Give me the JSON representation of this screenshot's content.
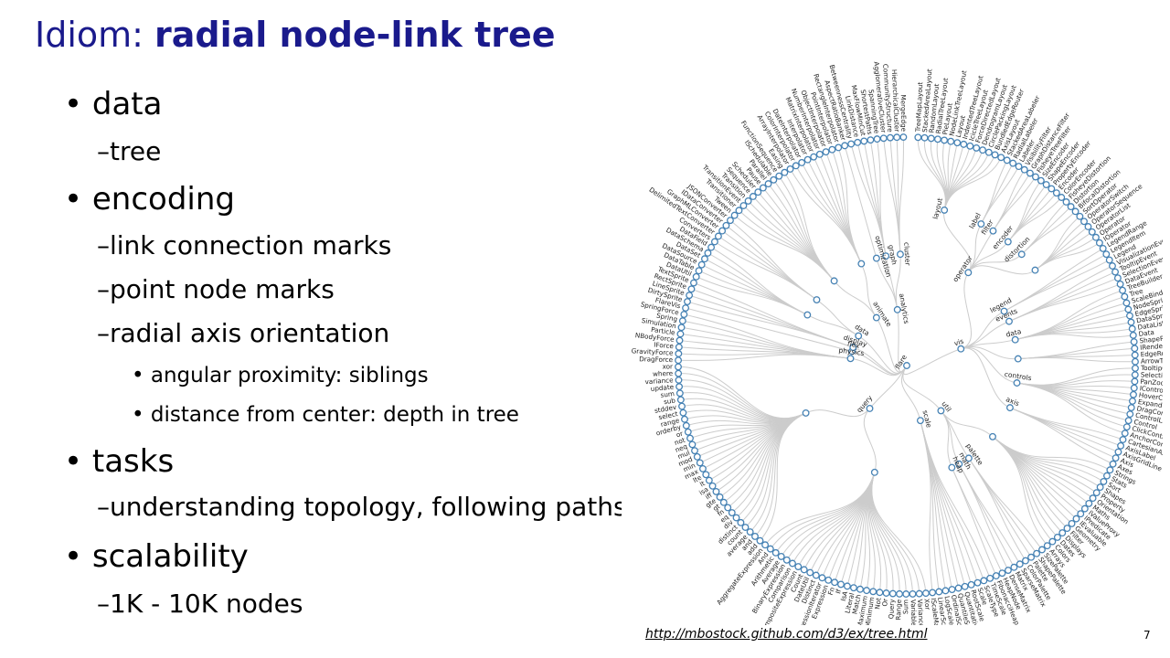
{
  "slide": {
    "title_regular": "Idiom: ",
    "title_bold": "radial node-link tree",
    "bullets": [
      {
        "level": 1,
        "marker": "•",
        "text": "data"
      },
      {
        "level": 2,
        "marker": "–",
        "text": "tree"
      },
      {
        "level": 1,
        "marker": "•",
        "text": "encoding"
      },
      {
        "level": 2,
        "marker": "–",
        "text": "link connection marks"
      },
      {
        "level": 2,
        "marker": "–",
        "text": "point node marks"
      },
      {
        "level": 2,
        "marker": "–",
        "text": "radial axis orientation"
      },
      {
        "level": 3,
        "marker": "•",
        "text": "angular proximity: siblings"
      },
      {
        "level": 3,
        "marker": "•",
        "text": "distance from center: depth in tree"
      },
      {
        "level": 1,
        "marker": "•",
        "text": "tasks"
      },
      {
        "level": 2,
        "marker": "–",
        "text": "understanding topology,  following paths"
      },
      {
        "level": 1,
        "marker": "•",
        "text": "scalability"
      },
      {
        "level": 2,
        "marker": "–",
        "text": "1K - 10K nodes"
      }
    ],
    "footer_link": "http://mbostock.github.com/d3/ex/tree.html",
    "page_number": "7"
  },
  "tree": {
    "root": "flare",
    "groups": [
      {
        "name": "vis",
        "children": [
          {
            "name": "operator",
            "children": [
              {
                "name": "layout",
                "children": [
                  "TreeMapLayout",
                  "StackedAreaLayout",
                  "RandomLayout",
                  "RadialTreeLayout",
                  "PieLayout",
                  "NodeLinkTreeLayout",
                  "Layout",
                  "IndentedTreeLayout",
                  "IcicleTreeLayout",
                  "ForceDirectedLayout",
                  "DendrogramLayout",
                  "CirclePackingLayout",
                  "BundledEdgeRouter",
                  "AxisLayout"
                ]
              },
              {
                "name": "label",
                "children": [
                  "StackedAreaLabeler",
                  "RadialLabeler",
                  "Labeler"
                ]
              },
              {
                "name": "filter",
                "children": [
                  "VisibilityFilter",
                  "GraphDistanceFilter",
                  "FisheyeTreeFilter"
                ]
              },
              {
                "name": "encoder",
                "children": [
                  "SizeEncoder",
                  "ShapeEncoder",
                  "PropertyEncoder",
                  "Encoder",
                  "ColorEncoder"
                ]
              },
              {
                "name": "distortion",
                "children": [
                  "FisheyeDistortion",
                  "Distortion",
                  "BifocalDistortion"
                ]
              },
              {
                "name": "leaves",
                "children": [
                  "SortOperator",
                  "OperatorSwitch",
                  "OperatorSequence",
                  "OperatorList",
                  "Operator",
                  "IOperator"
                ]
              }
            ]
          },
          {
            "name": "legend",
            "children": [
              "LegendRange",
              "LegendItem",
              "Legend"
            ]
          },
          {
            "name": "events",
            "children": [
              "VisualizationEvent",
              "TooltipEvent",
              "SelectionEvent",
              "DataEvent"
            ]
          },
          {
            "name": "data",
            "children": [
              "TreeBuilder",
              "Tree",
              "ScaleBinding",
              "NodeSprite",
              "EdgeSprite",
              "DataSprite",
              "DataList",
              "Data"
            ]
          },
          {
            "name": "data-render",
            "children": [
              "ShapeRenderer",
              "IRenderer",
              "EdgeRenderer",
              "ArrowType"
            ]
          },
          {
            "name": "controls",
            "children": [
              "TooltipControl",
              "SelectionControl",
              "PanZoomControl",
              "IControl",
              "HoverControl",
              "ExpandControl",
              "DragControl",
              "ControlList",
              "Control",
              "ClickControl",
              "AnchorControl"
            ]
          },
          {
            "name": "axis",
            "children": [
              "CartesianAxes",
              "AxisLabel",
              "AxisGridLine",
              "Axis",
              "Axes"
            ]
          }
        ]
      },
      {
        "name": "util",
        "children": [
          {
            "name": "leaves",
            "children": [
              "Strings",
              "Stats",
              "Sort",
              "Shapes",
              "Property",
              "Orientation",
              "Maths",
              "IValueProxy",
              "IPredicate",
              "IEvaluable",
              "Geometry",
              "Filter",
              "Displays",
              "Dates",
              "Colors",
              "Arrays"
            ]
          },
          {
            "name": "palette",
            "children": [
              "SizePalette",
              "ShapePalette",
              "Palette",
              "ColorPalette"
            ]
          },
          {
            "name": "math",
            "children": [
              "SparseMatrix",
              "Matrix",
              "DenseMatrix"
            ]
          },
          {
            "name": "heap",
            "children": [
              "HeapNode",
              "FibonacciHeap"
            ]
          }
        ]
      },
      {
        "name": "scale",
        "children": [
          "TimeScale",
          "ScaleType",
          "Scale",
          "RootScale",
          "QuantitativeScale",
          "QuantileScale",
          "OrdinalScale",
          "LogScale",
          "LinearScale",
          "IScaleMap"
        ]
      },
      {
        "name": "query",
        "children": [
          {
            "name": "leaves",
            "children": [
              "Xor",
              "Variance",
              "Variable",
              "Sum",
              "Range",
              "Query",
              "Or",
              "Not",
              "Minimum",
              "Maximum",
              "Match",
              "Literal",
              "IsA",
              "If",
              "Fn",
              "Expression",
              "ExpressionIterator",
              "Distinct",
              "DateUtil",
              "Count",
              "CompositeExpression",
              "Comparison",
              "BinaryExpression",
              "Average",
              "Arithmetic",
              "And",
              "AggregateExpression"
            ]
          },
          {
            "name": "methods",
            "children": [
              "add",
              "and",
              "average",
              "count",
              "distinct",
              "div",
              "eq",
              "fn",
              "gt",
              "gte",
              "iff",
              "isa",
              "lt",
              "lte",
              "max",
              "min",
              "mod",
              "mul",
              "neq",
              "not",
              "or",
              "orderby",
              "range",
              "select",
              "stddev",
              "sub",
              "sum",
              "update",
              "variance",
              "where",
              "xor"
            ]
          }
        ]
      },
      {
        "name": "physics",
        "children": [
          "DragForce",
          "GravityForce",
          "IForce",
          "NBodyForce",
          "Particle",
          "Simulation",
          "Spring",
          "SpringForce"
        ]
      },
      {
        "name": "flex",
        "children": [
          "FlareVis"
        ]
      },
      {
        "name": "display",
        "children": [
          "DirtySprite",
          "LineSprite",
          "RectSprite",
          "TextSprite"
        ]
      },
      {
        "name": "data",
        "children": [
          {
            "name": "leaves",
            "children": [
              "DataUtil",
              "DataTable",
              "DataSource",
              "DataSet",
              "DataSchema",
              "DataField"
            ]
          },
          {
            "name": "converters",
            "children": [
              "Converters",
              "DelimitedTextConverter",
              "GraphMLConverter",
              "IDataConverter",
              "JSONConverter"
            ]
          }
        ]
      },
      {
        "name": "animate",
        "children": [
          {
            "name": "leaves",
            "children": [
              "Tween",
              "Transitioner",
              "TransitionEvent",
              "Transition",
              "Sequence",
              "Scheduler",
              "Pause",
              "Parallel",
              "ISchedulable",
              "FunctionSequence",
              "Easing"
            ]
          },
          {
            "name": "interpolate",
            "children": [
              "ArrayInterpolator",
              "ColorInterpolator",
              "DateInterpolator",
              "Interpolator",
              "MatrixInterpolator",
              "NumberInterpolator",
              "ObjectInterpolator",
              "PointInterpolator",
              "RectangleInterpolator"
            ]
          }
        ]
      },
      {
        "name": "analytics",
        "children": [
          {
            "name": "optimization",
            "children": [
              "AspectRatioBanker"
            ]
          },
          {
            "name": "graph",
            "children": [
              "BetweennessCentrality",
              "LinkDistance",
              "MaxFlowMinCut",
              "ShortestPaths",
              "SpanningTree"
            ]
          },
          {
            "name": "cluster",
            "children": [
              "AgglomerativeCluster",
              "CommunityStructure",
              "HierarchicalCluster",
              "MergeEdge"
            ]
          }
        ]
      }
    ]
  }
}
